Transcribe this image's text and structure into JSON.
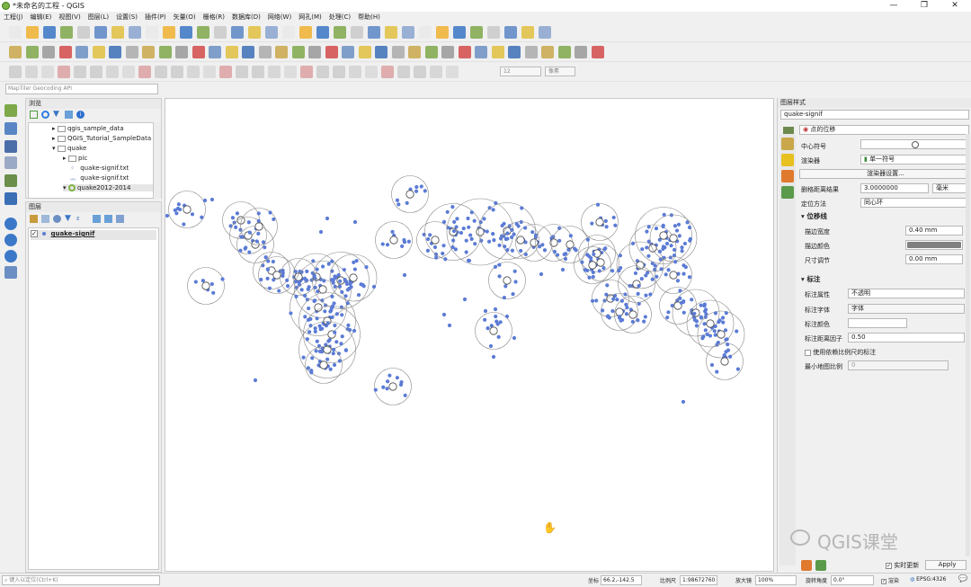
{
  "window": {
    "title": "*未命名的工程 - QGIS",
    "minimize": "—",
    "maximize": "❐",
    "close": "✕"
  },
  "menu": [
    "工程(J)",
    "编辑(E)",
    "视图(V)",
    "图层(L)",
    "设置(S)",
    "插件(P)",
    "矢量(O)",
    "栅格(R)",
    "数据库(D)",
    "网络(W)",
    "网孔(M)",
    "处理(C)",
    "帮助(H)"
  ],
  "toolbar3": {
    "spin_value": "12",
    "units": "像素"
  },
  "geocode_placeholder": "MapTiler Geocoding API",
  "browser": {
    "title": "浏览",
    "items": [
      {
        "label": "qgis_sample_data",
        "arrow": "▸",
        "icon": "folder"
      },
      {
        "label": "QGIS_Tutorial_SampleData",
        "arrow": "▸",
        "icon": "folder"
      },
      {
        "label": "quake",
        "arrow": "▾",
        "icon": "folder"
      },
      {
        "label": "pic",
        "arrow": "▸",
        "icon": "folder"
      },
      {
        "label": "quake-signif.txt",
        "arrow": "",
        "icon": "points"
      },
      {
        "label": "quake-signif.txt",
        "arrow": "",
        "icon": "line"
      },
      {
        "label": "quake2012-2014",
        "arrow": "▾",
        "icon": "qgis"
      }
    ]
  },
  "layers": {
    "title": "图层",
    "items": [
      {
        "label": "quake-signif",
        "checked": true
      }
    ]
  },
  "style": {
    "title": "图层样式",
    "layer": "quake-signif",
    "renderer_type": "点的位移",
    "center_symbol_label": "中心符号",
    "renderer_label": "渲染器",
    "renderer_value": "单一符号",
    "renderer_settings": "渲染器设置...",
    "distance_label": "删格距离结果",
    "distance_value": "3.0000000",
    "distance_unit": "毫米",
    "placement_label": "定位方法",
    "placement_value": "同心环",
    "sec_displacement": "位移线",
    "stroke_width_label": "描边宽度",
    "stroke_width_value": "0.40 mm",
    "stroke_color_label": "描边颜色",
    "stroke_color": "#808080",
    "size_adj_label": "尺寸调节",
    "size_adj_value": "0.00 mm",
    "sec_labels": "标注",
    "label_attr_label": "标注属性",
    "label_attr_value": "不透明",
    "label_font_label": "标注字体",
    "label_font_value": "字体",
    "label_color_label": "标注颜色",
    "label_dist_label": "标注距离因子",
    "label_dist_value": "0.50",
    "use_scale_label": "使用依赖比例尺的标注",
    "min_scale_label": "最小地图比例",
    "min_scale_value": "0",
    "live_update": "实时更新",
    "apply": "Apply"
  },
  "watermark": "QGIS课堂",
  "status": {
    "locate_placeholder": "键入以定位(Ctrl+K)",
    "coord_label": "坐标",
    "coord_value": "66.2,-142.5",
    "scale_label": "比例尺",
    "scale_value": "1:98672760",
    "magnifier_label": "放大镜",
    "magnifier_value": "100%",
    "rotation_label": "旋转角度",
    "rotation_value": "0.0°",
    "render_label": "渲染",
    "crs": "EPSG:4326"
  },
  "colors": {
    "points": "#5b7bd5",
    "accent": "#2f7de1"
  }
}
